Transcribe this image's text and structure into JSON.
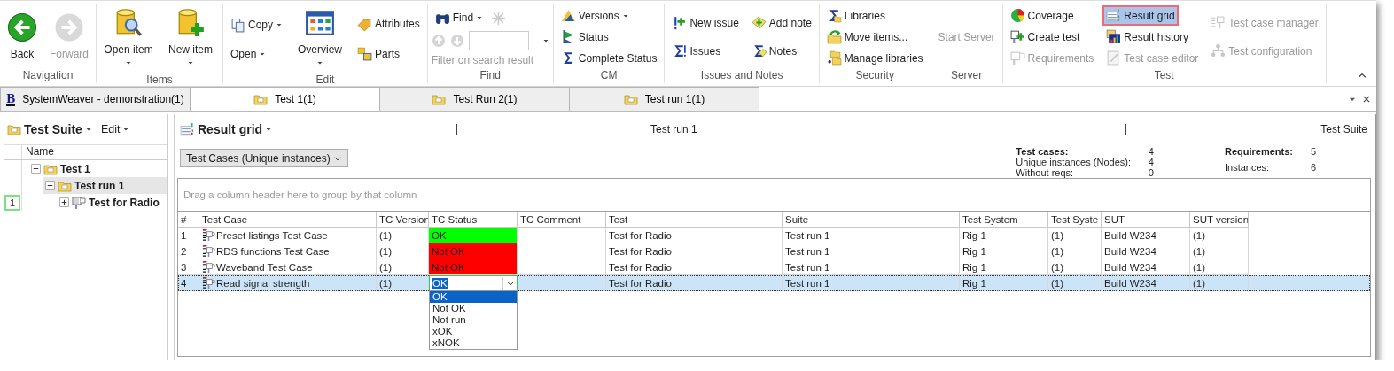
{
  "ribbon": {
    "groups": [
      {
        "label": "Navigation",
        "kind": "buttons",
        "columns": [
          [
            {
              "label": "Back",
              "kind": "large",
              "disabled": false,
              "dropdown": false,
              "highlighted": false
            }
          ],
          [
            {
              "label": "Forward",
              "kind": "large",
              "disabled": true,
              "dropdown": false,
              "highlighted": false
            }
          ]
        ]
      },
      {
        "label": "Items",
        "kind": "buttons",
        "columns": [
          [
            {
              "label": "Open item",
              "kind": "large",
              "disabled": false,
              "dropdown": true,
              "highlighted": false
            }
          ],
          [
            {
              "label": "New item",
              "kind": "large",
              "disabled": false,
              "dropdown": true,
              "highlighted": false
            }
          ]
        ]
      },
      {
        "label": "Edit",
        "kind": "buttons",
        "columns": [
          [
            {
              "label": "Copy",
              "kind": "small",
              "disabled": false,
              "dropdown": true,
              "highlighted": false
            },
            {
              "label": "Open",
              "kind": "small",
              "disabled": false,
              "dropdown": true,
              "highlighted": false
            }
          ],
          [
            {
              "label": "Overview",
              "kind": "large",
              "disabled": false,
              "dropdown": true,
              "highlighted": false
            }
          ],
          [
            {
              "label": "Attributes",
              "kind": "small",
              "disabled": false,
              "dropdown": false,
              "highlighted": false
            },
            {
              "label": "Parts",
              "kind": "small",
              "disabled": false,
              "dropdown": false,
              "highlighted": false
            }
          ]
        ]
      },
      {
        "label": "Find",
        "kind": "find",
        "find_button": {
          "label": "Find",
          "dropdown": true
        },
        "filter": {
          "label": "Filter on search result",
          "disabled": true
        }
      },
      {
        "label": "CM",
        "kind": "buttons",
        "columns": [
          [
            {
              "label": "Versions",
              "kind": "small",
              "disabled": false,
              "dropdown": true,
              "highlighted": false
            },
            {
              "label": "Status",
              "kind": "small",
              "disabled": false,
              "dropdown": false,
              "highlighted": false
            },
            {
              "label": "Complete Status",
              "kind": "small",
              "disabled": false,
              "dropdown": false,
              "highlighted": false
            }
          ]
        ]
      },
      {
        "label": "Issues and Notes",
        "kind": "buttons",
        "columns": [
          [
            {
              "label": "New issue",
              "kind": "small",
              "disabled": false,
              "dropdown": false,
              "highlighted": false
            },
            {
              "label": "Issues",
              "kind": "small",
              "disabled": false,
              "dropdown": false,
              "highlighted": false
            }
          ],
          [
            {
              "label": "Add note",
              "kind": "small",
              "disabled": false,
              "dropdown": false,
              "highlighted": false
            },
            {
              "label": "Notes",
              "kind": "small",
              "disabled": false,
              "dropdown": false,
              "highlighted": false
            }
          ]
        ]
      },
      {
        "label": "Security",
        "kind": "buttons",
        "columns": [
          [
            {
              "label": "Libraries",
              "kind": "small",
              "disabled": false,
              "dropdown": false,
              "highlighted": false
            },
            {
              "label": "Move items...",
              "kind": "small",
              "disabled": false,
              "dropdown": false,
              "highlighted": false
            },
            {
              "label": "Manage libraries",
              "kind": "small",
              "disabled": false,
              "dropdown": false,
              "highlighted": false
            }
          ]
        ]
      },
      {
        "label": "Server",
        "kind": "buttons",
        "columns": [
          [
            {
              "label": "Start Server",
              "kind": "small",
              "disabled": true,
              "dropdown": false,
              "highlighted": false
            }
          ]
        ]
      },
      {
        "label": "Test",
        "kind": "buttons",
        "columns": [
          [
            {
              "label": "Coverage",
              "kind": "small",
              "disabled": false,
              "dropdown": false,
              "highlighted": false
            },
            {
              "label": "Create test",
              "kind": "small",
              "disabled": false,
              "dropdown": false,
              "highlighted": false
            },
            {
              "label": "Requirements",
              "kind": "small",
              "disabled": true,
              "dropdown": false,
              "highlighted": false
            }
          ],
          [
            {
              "label": "Result grid",
              "kind": "small",
              "disabled": false,
              "dropdown": false,
              "highlighted": true
            },
            {
              "label": "Result history",
              "kind": "small",
              "disabled": false,
              "dropdown": false,
              "highlighted": false
            },
            {
              "label": "Test case editor",
              "kind": "small",
              "disabled": true,
              "dropdown": false,
              "highlighted": false
            }
          ],
          [
            {
              "label": "Test case manager",
              "kind": "small",
              "disabled": true,
              "dropdown": false,
              "highlighted": false
            },
            {
              "label": "Test configuration",
              "kind": "small",
              "disabled": true,
              "dropdown": false,
              "highlighted": false
            }
          ]
        ]
      }
    ]
  },
  "tabs": [
    {
      "label": "SystemWeaver - demonstration(1)",
      "logo": "B",
      "selected": false
    },
    {
      "label": "Test 1(1)",
      "selected": true
    },
    {
      "label": "Test Run 2(1)",
      "selected": false
    },
    {
      "label": "Test run 1(1)",
      "selected": false
    }
  ],
  "explorer": {
    "title": "Test Suite",
    "menu": "Edit",
    "column": "Name",
    "tree": [
      {
        "label": "Test 1",
        "expanded": true,
        "selected": false,
        "children": [
          {
            "label": "Test run 1",
            "expanded": true,
            "selected": true,
            "children": [
              {
                "label": "Test for Radio",
                "expanded": false,
                "selected": false,
                "badge": "1"
              }
            ]
          }
        ]
      }
    ]
  },
  "result_grid": {
    "title": "Result grid",
    "context": "Test run 1",
    "scope": "Test Suite",
    "view_select": "Test Cases (Unique instances)",
    "stats": [
      [
        {
          "label": "Test cases:",
          "value": "4",
          "kind": "heading"
        },
        {
          "label": "Unique instances (Nodes):",
          "value": "4",
          "kind": "line"
        },
        {
          "label": "Without reqs:",
          "value": "0",
          "kind": "line"
        }
      ],
      [
        {
          "label": "Requirements:",
          "value": "5",
          "kind": "heading"
        },
        {
          "label": "Instances:",
          "value": "6",
          "kind": "line"
        }
      ]
    ],
    "group_hint": "Drag a column header here to group by that column",
    "columns": [
      "#",
      "Test Case",
      "TC Version",
      "TC Status",
      "TC Comment",
      "Test",
      "Suite",
      "Test System",
      "Test Syste",
      "SUT",
      "SUT version"
    ],
    "rows": [
      {
        "selected": false,
        "editing": false,
        "color": "#00ff00",
        "cells": [
          "1",
          "Preset listings Test Case",
          "(1)",
          "OK",
          "",
          "Test for Radio",
          "Test run 1",
          "Rig 1",
          "(1)",
          "Build W234",
          "(1)"
        ]
      },
      {
        "selected": false,
        "editing": false,
        "color": "#ff0000",
        "cells": [
          "2",
          "RDS functions Test Case",
          "(1)",
          "Not OK",
          "",
          "Test for Radio",
          "Test run 1",
          "Rig 1",
          "(1)",
          "Build W234",
          "(1)"
        ]
      },
      {
        "selected": false,
        "editing": false,
        "color": "#ff0000",
        "cells": [
          "3",
          "Waveband Test Case",
          "(1)",
          "Not OK",
          "",
          "Test for Radio",
          "Test run 1",
          "Rig 1",
          "(1)",
          "Build W234",
          "(1)"
        ]
      },
      {
        "selected": true,
        "editing": true,
        "color": "#ffffff",
        "cells": [
          "4",
          "Read signal strength",
          "(1)",
          "OK",
          "",
          "Test for Radio",
          "Test run 1",
          "Rig 1",
          "(1)",
          "Build W234",
          "(1)"
        ]
      }
    ],
    "status_options": [
      {
        "label": "OK",
        "selected": true
      },
      {
        "label": "Not OK",
        "selected": false
      },
      {
        "label": "Not run",
        "selected": false
      },
      {
        "label": "xOK",
        "selected": false
      },
      {
        "label": "xNOK",
        "selected": false
      }
    ]
  }
}
